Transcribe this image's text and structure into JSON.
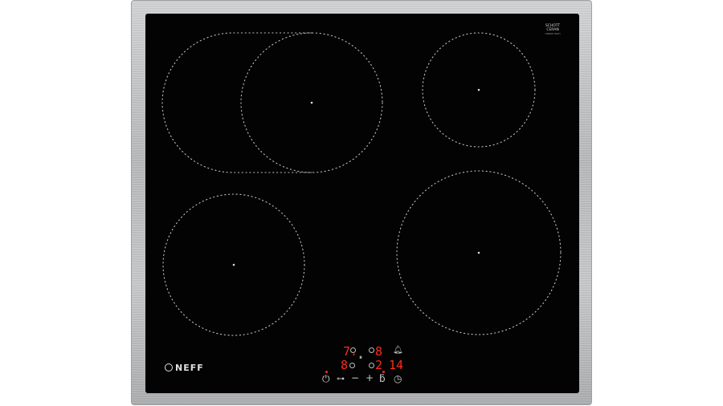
{
  "brand": {
    "name": "NEFF",
    "glass_maker_line1": "SCHOTT",
    "glass_maker_line2": "CERAN",
    "glass_maker_small": "CERAN HIGH"
  },
  "colors": {
    "glass": "#030303",
    "frame": "#c2c3c5",
    "zone_outline": "#bdbdbd",
    "display_red": "#ff2a1a"
  },
  "zones": [
    {
      "name": "rear-left-dual-zone",
      "shape": "extended oval"
    },
    {
      "name": "rear-right-zone",
      "shape": "circle"
    },
    {
      "name": "front-left-zone",
      "shape": "circle"
    },
    {
      "name": "front-right-zone",
      "shape": "circle"
    }
  ],
  "control_panel": {
    "top_left_digit": "7.",
    "top_right_digit": "8",
    "bottom_left_digit": "8",
    "bottom_middle_digit": "2",
    "bottom_right_digits": "14",
    "icons": [
      "power-icon",
      "combine-icon",
      "minus-icon",
      "plus-icon",
      "timer-icon",
      "clock-icon",
      "bell-icon",
      "lock-icon"
    ]
  }
}
